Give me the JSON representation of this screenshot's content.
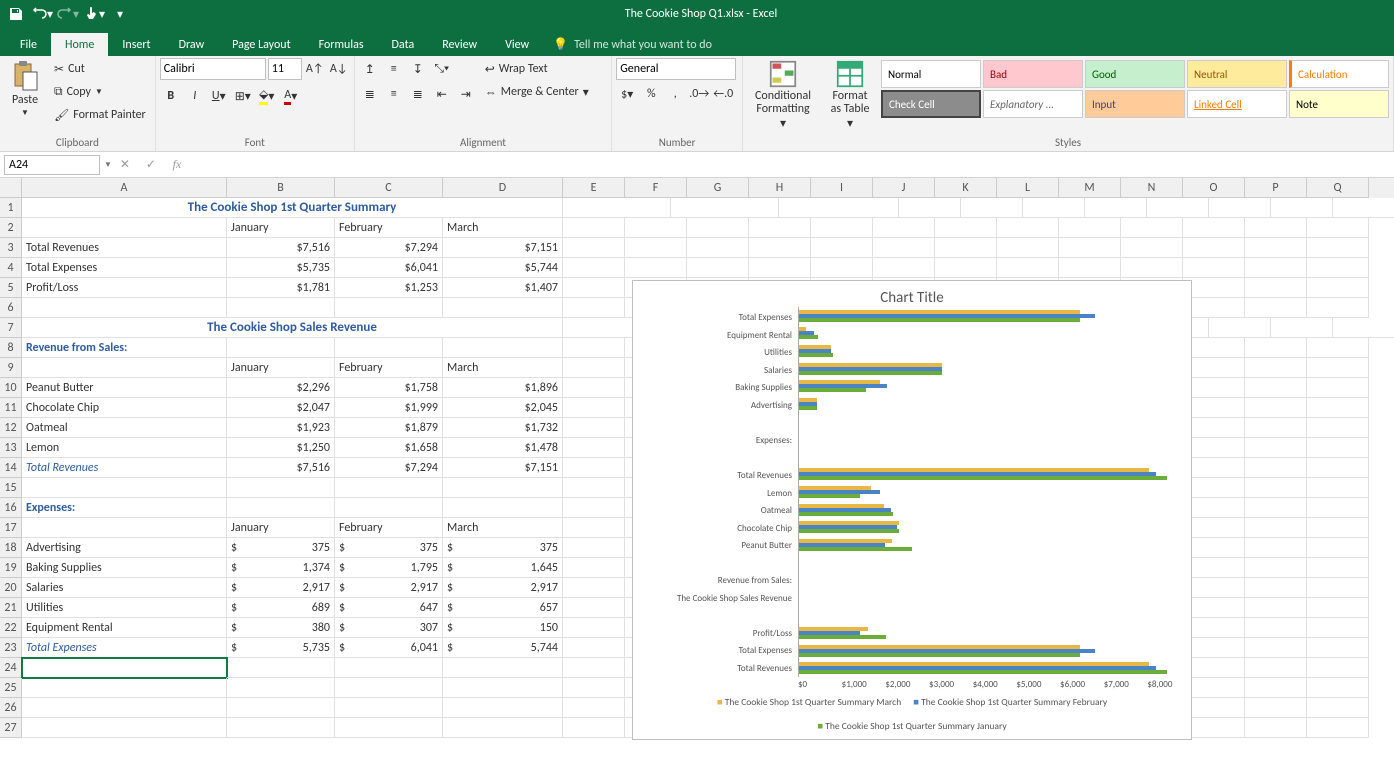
{
  "app": {
    "title": "The Cookie Shop Q1.xlsx  -  Excel"
  },
  "qat": {
    "save": "save",
    "undo": "undo",
    "redo": "redo",
    "touch": "touch",
    "custom": "customize"
  },
  "tabs": [
    "File",
    "Home",
    "Insert",
    "Draw",
    "Page Layout",
    "Formulas",
    "Data",
    "Review",
    "View"
  ],
  "tellme": "Tell me what you want to do",
  "ribbon": {
    "clipboard": {
      "paste": "Paste",
      "cut": "Cut",
      "copy": "Copy",
      "fmtp": "Format Painter",
      "label": "Clipboard"
    },
    "font": {
      "name": "Calibri",
      "size": "11",
      "label": "Font",
      "bold": "B",
      "italic": "I",
      "underline": "U"
    },
    "alignment": {
      "wrap": "Wrap Text",
      "merge": "Merge & Center",
      "label": "Alignment"
    },
    "number": {
      "fmt": "General",
      "label": "Number"
    },
    "styles": {
      "cond": "Conditional Formatting",
      "table": "Format as Table",
      "label": "Styles",
      "cells": [
        "Normal",
        "Bad",
        "Good",
        "Neutral",
        "Calculation",
        "Check Cell",
        "Explanatory ...",
        "Input",
        "Linked Cell",
        "Note"
      ]
    }
  },
  "fbar": {
    "name": "A24",
    "formula": ""
  },
  "columns": [
    "A",
    "B",
    "C",
    "D",
    "E",
    "F",
    "G",
    "H",
    "I",
    "J",
    "K",
    "L",
    "M",
    "N",
    "O",
    "P",
    "Q"
  ],
  "sheet": {
    "title1": "The Cookie Shop 1st Quarter Summary",
    "months": [
      "January",
      "February",
      "March"
    ],
    "summary_rows": [
      {
        "label": "Total Revenues",
        "vals": [
          "$7,516",
          "$7,294",
          "$7,151"
        ]
      },
      {
        "label": "Total Expenses",
        "vals": [
          "$5,735",
          "$6,041",
          "$5,744"
        ]
      },
      {
        "label": "Profit/Loss",
        "vals": [
          "$1,781",
          "$1,253",
          "$1,407"
        ]
      }
    ],
    "title2": "The Cookie Shop Sales Revenue",
    "rev_header": "Revenue from Sales:",
    "rev_rows": [
      {
        "label": "Peanut Butter",
        "vals": [
          "$2,296",
          "$1,758",
          "$1,896"
        ]
      },
      {
        "label": "Chocolate Chip",
        "vals": [
          "$2,047",
          "$1,999",
          "$2,045"
        ]
      },
      {
        "label": "Oatmeal",
        "vals": [
          "$1,923",
          "$1,879",
          "$1,732"
        ]
      },
      {
        "label": "Lemon",
        "vals": [
          "$1,250",
          "$1,658",
          "$1,478"
        ]
      }
    ],
    "rev_total": {
      "label": "Total Revenues",
      "vals": [
        "$7,516",
        "$7,294",
        "$7,151"
      ]
    },
    "exp_header": "Expenses:",
    "exp_rows": [
      {
        "label": "Advertising",
        "vals": [
          "375",
          "375",
          "375"
        ]
      },
      {
        "label": "Baking Supplies",
        "vals": [
          "1,374",
          "1,795",
          "1,645"
        ]
      },
      {
        "label": "Salaries",
        "vals": [
          "2,917",
          "2,917",
          "2,917"
        ]
      },
      {
        "label": "Utilities",
        "vals": [
          "689",
          "647",
          "657"
        ]
      },
      {
        "label": "Equipment Rental",
        "vals": [
          "380",
          "307",
          "150"
        ]
      }
    ],
    "exp_total": {
      "label": "Total Expenses",
      "vals": [
        "5,735",
        "6,041",
        "5,744"
      ]
    },
    "cur": "$"
  },
  "chart_data": {
    "type": "bar",
    "title": "Chart Title",
    "xlabel": "",
    "ylabel": "",
    "xticks": [
      "$0",
      "$1,000",
      "$2,000",
      "$3,000",
      "$4,000",
      "$5,000",
      "$6,000",
      "$7,000",
      "$8,000"
    ],
    "xlim": [
      0,
      8000
    ],
    "categories": [
      "Total Expenses",
      "Equipment Rental",
      "Utilities",
      "Salaries",
      "Baking Supplies",
      "Advertising",
      "",
      "Expenses:",
      "",
      "Total Revenues",
      "Lemon",
      "Oatmeal",
      "Chocolate Chip",
      "Peanut Butter",
      "",
      "Revenue from Sales:",
      "The Cookie Shop Sales Revenue",
      "",
      "Profit/Loss",
      "Total Expenses",
      "Total Revenues"
    ],
    "series": [
      {
        "name": "The Cookie Shop 1st Quarter Summary March",
        "color": "#e8b846",
        "values": [
          5744,
          150,
          657,
          2917,
          1645,
          375,
          null,
          null,
          null,
          7151,
          1478,
          1732,
          2045,
          1896,
          null,
          null,
          null,
          null,
          1407,
          5744,
          7151
        ]
      },
      {
        "name": "The Cookie Shop 1st Quarter Summary February",
        "color": "#4a84c4",
        "values": [
          6041,
          307,
          647,
          2917,
          1795,
          375,
          null,
          null,
          null,
          7294,
          1658,
          1879,
          1999,
          1758,
          null,
          null,
          null,
          null,
          1253,
          6041,
          7294
        ]
      },
      {
        "name": "The Cookie Shop 1st Quarter Summary January",
        "color": "#6aad3b",
        "values": [
          5735,
          380,
          689,
          2917,
          1374,
          375,
          null,
          null,
          null,
          7516,
          1250,
          1923,
          2047,
          2296,
          null,
          null,
          null,
          null,
          1781,
          5735,
          7516
        ]
      }
    ],
    "legend_position": "bottom"
  }
}
